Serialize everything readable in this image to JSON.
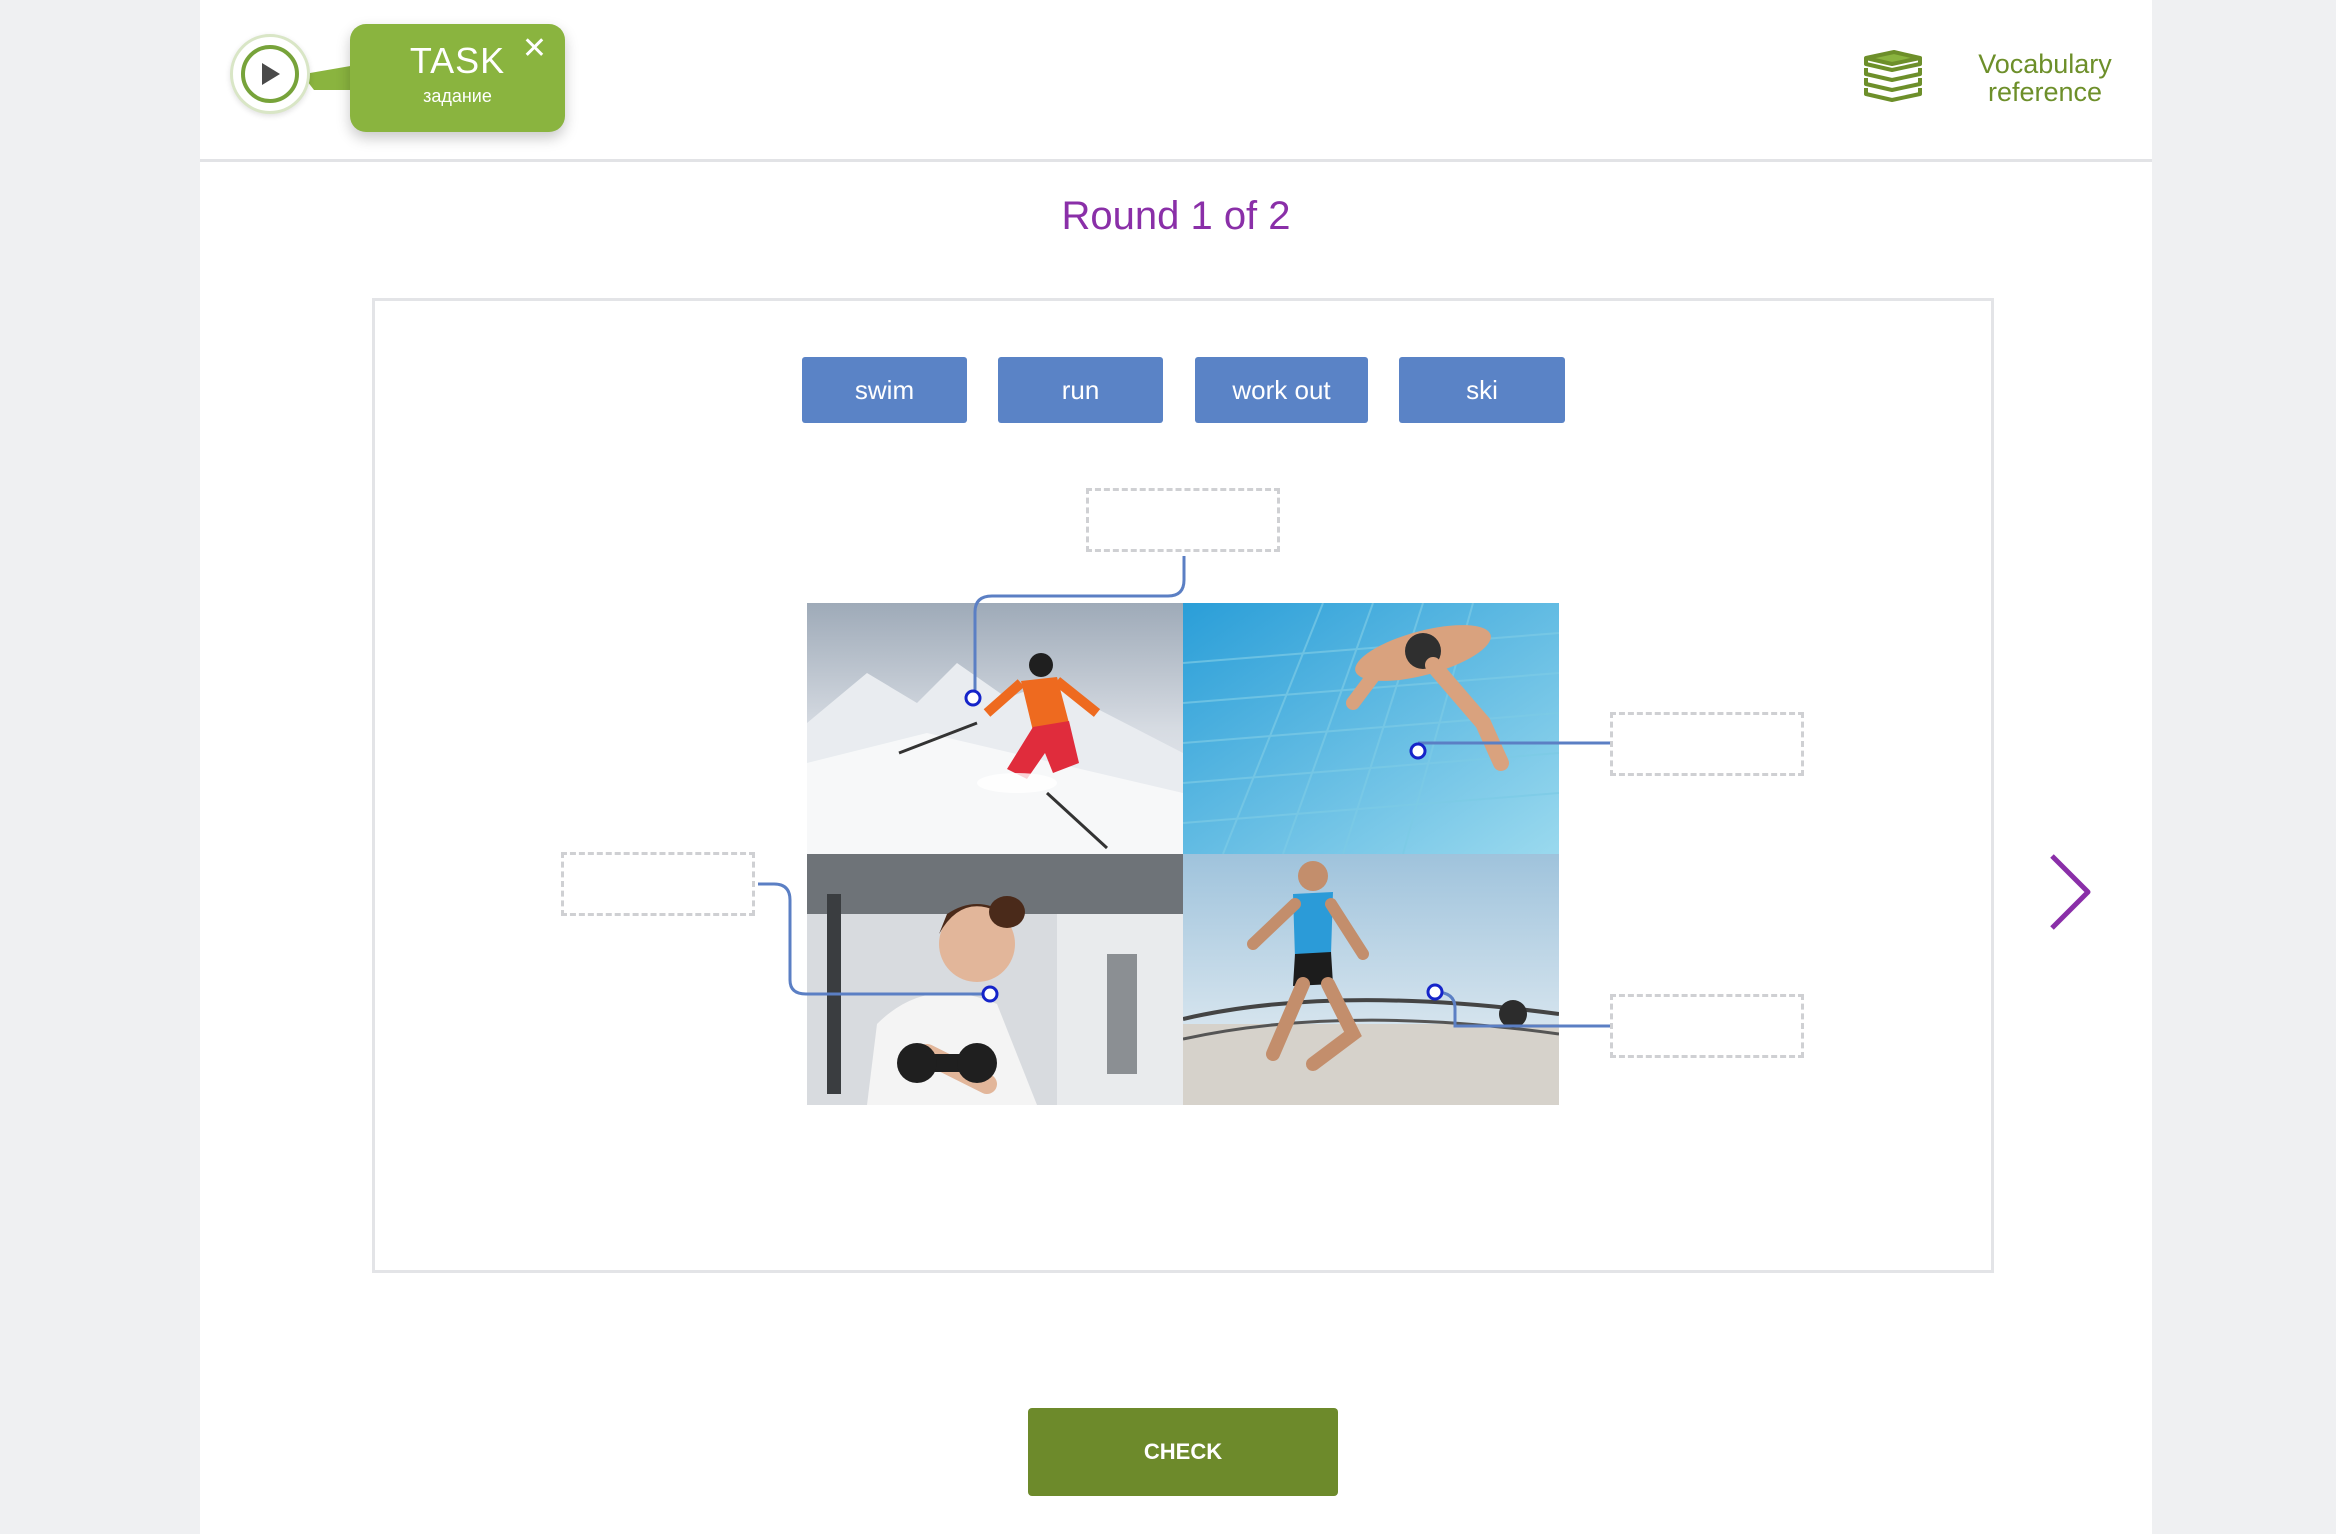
{
  "header": {
    "task_title": "TASK",
    "task_subtitle": "задание",
    "task_close": "✕",
    "vocab_line1": "Vocabulary",
    "vocab_line2": "reference"
  },
  "round": {
    "title": "Round 1 of 2"
  },
  "word_bank": [
    {
      "label": "swim"
    },
    {
      "label": "run"
    },
    {
      "label": "work out"
    },
    {
      "label": "ski"
    }
  ],
  "drop_zones": [
    {
      "target": "skier",
      "value": ""
    },
    {
      "target": "swimmer",
      "value": ""
    },
    {
      "target": "woman-with-dumbbells",
      "value": ""
    },
    {
      "target": "runner",
      "value": ""
    }
  ],
  "photos": [
    {
      "subject": "skier on snowy slope"
    },
    {
      "subject": "swimmer in pool"
    },
    {
      "subject": "woman lifting dumbbells in gym"
    },
    {
      "subject": "man running on waterfront"
    }
  ],
  "footer": {
    "check_label": "CHECK"
  },
  "colors": {
    "accent_green": "#8ab43f",
    "check_green": "#6d8a2b",
    "chip_blue": "#5a83c6",
    "title_purple": "#8a2fa8",
    "connector_blue": "#5b7fc4"
  },
  "icons": [
    "play-icon",
    "close-icon",
    "books-icon",
    "chevron-right-icon"
  ]
}
